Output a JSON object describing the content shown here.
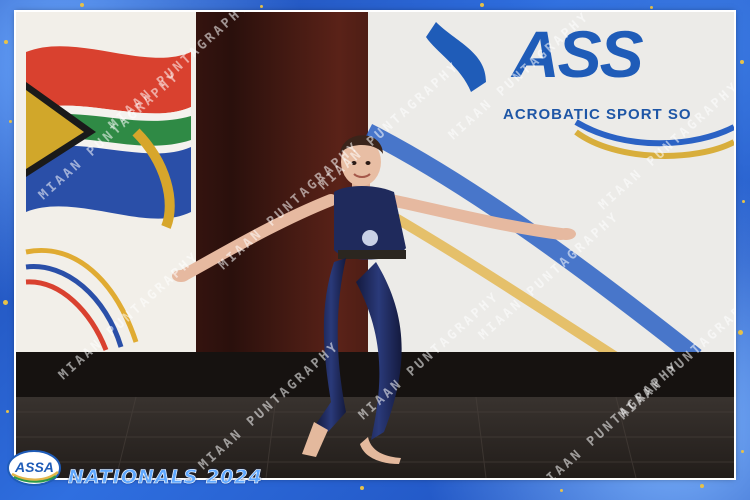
{
  "banner": {
    "initials": "ASS",
    "org_text": "ACROBATIC SPORT SO"
  },
  "event": {
    "logo_text": "ASSA",
    "title": "NATIONALS 2024"
  },
  "watermark": {
    "text": "MIAAN PUNTAGRAPHY"
  },
  "colors": {
    "frame_blue": "#1d4fb8",
    "banner_blue": "#1e56a6",
    "costume_navy": "#1f2a5c",
    "speck_gold": "#e7c24a"
  }
}
